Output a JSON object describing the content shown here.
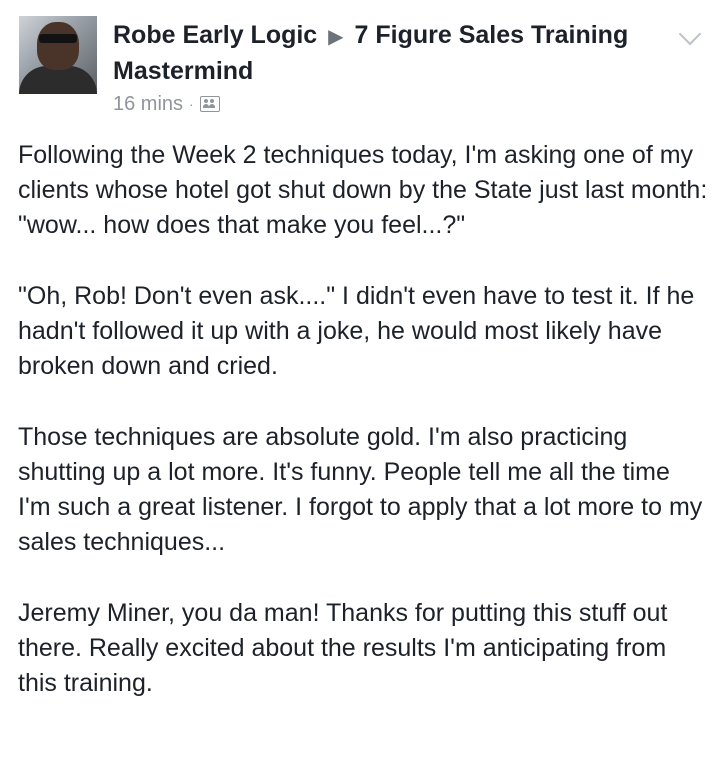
{
  "post": {
    "author": "Robe Early Logic",
    "group": "7 Figure Sales Training Mastermind",
    "time": "16 mins",
    "separator": "·",
    "privacy_icon": "group-icon",
    "menu_icon": "chevron-down-icon",
    "paragraphs": [
      "Following the Week 2 techniques today, I'm asking one of my clients whose hotel got shut down by the State just last month: \"wow... how does that make you feel...?\"",
      "\"Oh, Rob! Don't even ask....\" I didn't even have to test it. If he hadn't followed it up with a joke, he would most likely have broken down and cried.",
      "Those techniques are absolute gold. I'm also practicing shutting up a lot more. It's funny. People tell me all the time I'm such a great listener. I forgot to apply that a lot more to my sales techniques...",
      "Jeremy Miner, you da man! Thanks for putting this stuff out there. Really excited about the results I'm anticipating from this training."
    ]
  }
}
